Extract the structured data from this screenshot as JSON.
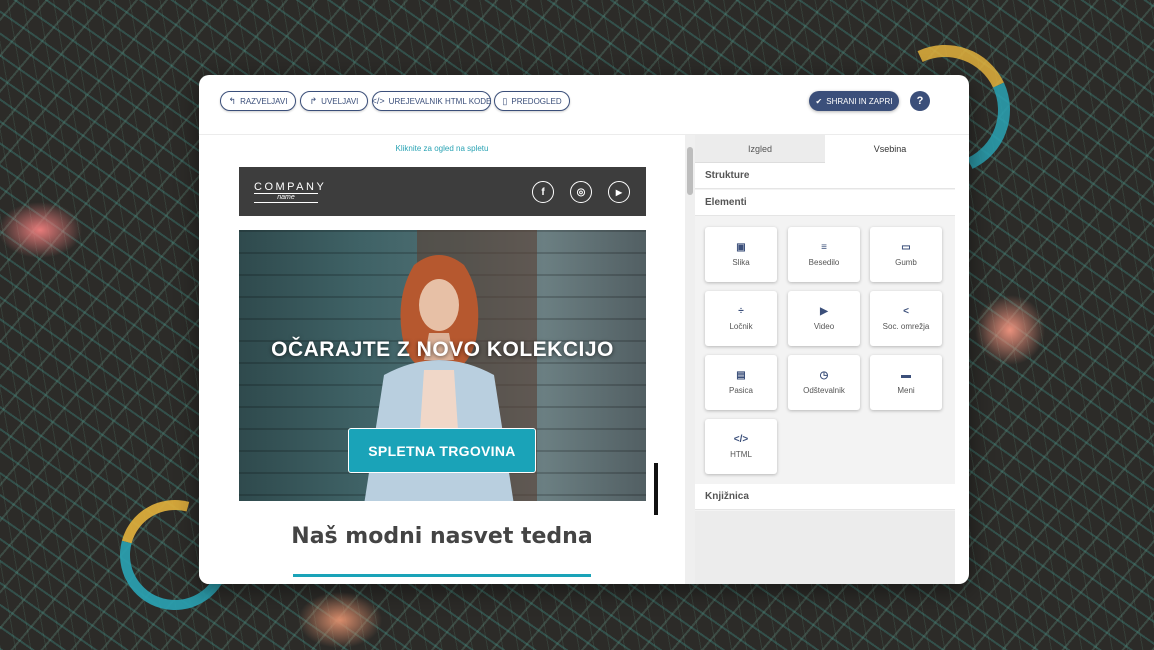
{
  "toolbar": {
    "undo": "RAZVELJAVI",
    "redo": "UVELJAVI",
    "html_editor": "UREJEVALNIK HTML KODE",
    "preview": "PREDOGLED",
    "save_close": "SHRANI IN ZAPRI",
    "help": "?"
  },
  "preview": {
    "web_link": "Kliknite za ogled na spletu",
    "logo_main": "COMPANY",
    "logo_sub": "name",
    "social_icons": [
      "facebook-icon",
      "instagram-icon",
      "youtube-icon"
    ],
    "social_glyphs": [
      "f",
      "◎",
      "▶"
    ],
    "hero_title": "OČARAJTE Z NOVO KOLEKCIJO",
    "hero_cta": "SPLETNA TRGOVINA",
    "tip_title": "Naš modni nasvet tedna"
  },
  "panel": {
    "tabs": [
      "Izgled",
      "Vsebina"
    ],
    "active_tab": "Vsebina",
    "structures": "Strukture",
    "elements": "Elementi",
    "library": "Knjižnica",
    "items": [
      {
        "label": "Slika",
        "icon": "image-icon",
        "glyph": "▣"
      },
      {
        "label": "Besedilo",
        "icon": "text-icon",
        "glyph": "≡"
      },
      {
        "label": "Gumb",
        "icon": "button-icon",
        "glyph": "▭"
      },
      {
        "label": "Ločnik",
        "icon": "divider-icon",
        "glyph": "÷"
      },
      {
        "label": "Video",
        "icon": "video-icon",
        "glyph": "▶"
      },
      {
        "label": "Soc. omrežja",
        "icon": "share-icon",
        "glyph": "<"
      },
      {
        "label": "Pasica",
        "icon": "banner-icon",
        "glyph": "▤"
      },
      {
        "label": "Odštevalnik",
        "icon": "timer-icon",
        "glyph": "◷"
      },
      {
        "label": "Meni",
        "icon": "menu-icon",
        "glyph": "▬"
      },
      {
        "label": "HTML",
        "icon": "code-icon",
        "glyph": "</>"
      }
    ]
  },
  "colors": {
    "primary": "#3b4f7a",
    "accent": "#1aa3b8",
    "header_bg": "#3d3d3d"
  }
}
